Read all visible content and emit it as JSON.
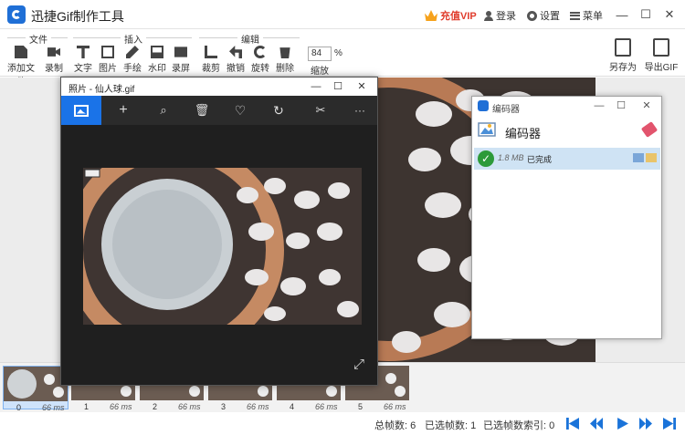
{
  "app": {
    "title": "迅捷Gif制作工具",
    "vip_label": "充值VIP",
    "login_label": "登录",
    "settings_label": "设置",
    "menu_label": "菜单",
    "minimize": "—",
    "maximize": "☐",
    "close": "✕"
  },
  "toolbar": {
    "groups": {
      "file": "文件",
      "insert": "插入",
      "edit": "编辑"
    },
    "tools": {
      "add_file": "添加文件",
      "record": "录制",
      "text": "文字",
      "image": "图片",
      "draw": "手绘",
      "watermark": "水印",
      "screen": "录屏",
      "crop": "裁剪",
      "undo": "撤销",
      "rotate": "旋转",
      "delete": "删除"
    },
    "zoom_value": "84",
    "zoom_unit": "%",
    "zoom_label": "缩放",
    "save_as": "另存为",
    "export_gif": "导出GIF"
  },
  "photos": {
    "title": "照片 - 仙人球.gif",
    "minimize": "—",
    "maximize": "☐",
    "close": "✕",
    "tools": [
      "view",
      "add",
      "zoom",
      "delete",
      "favorite",
      "rotate",
      "edit",
      "more"
    ]
  },
  "encoder": {
    "window_title": "编码器",
    "header": "编码器",
    "minimize": "—",
    "maximize": "☐",
    "close": "✕",
    "item": {
      "size": "1.8 MB",
      "status": "已完成"
    }
  },
  "frames": [
    {
      "index": "0",
      "delay": "66 ms"
    },
    {
      "index": "1",
      "delay": "66 ms"
    },
    {
      "index": "2",
      "delay": "66 ms"
    },
    {
      "index": "3",
      "delay": "66 ms"
    },
    {
      "index": "4",
      "delay": "66 ms"
    },
    {
      "index": "5",
      "delay": "66 ms"
    }
  ],
  "status": {
    "total_frames": "总帧数: 6",
    "selected_frames": "已选帧数: 1",
    "selected_index": "已选帧数索引: 0"
  },
  "colors": {
    "accent": "#1a73d9",
    "vip": "#e03c2c",
    "success": "#2c9a3a"
  }
}
